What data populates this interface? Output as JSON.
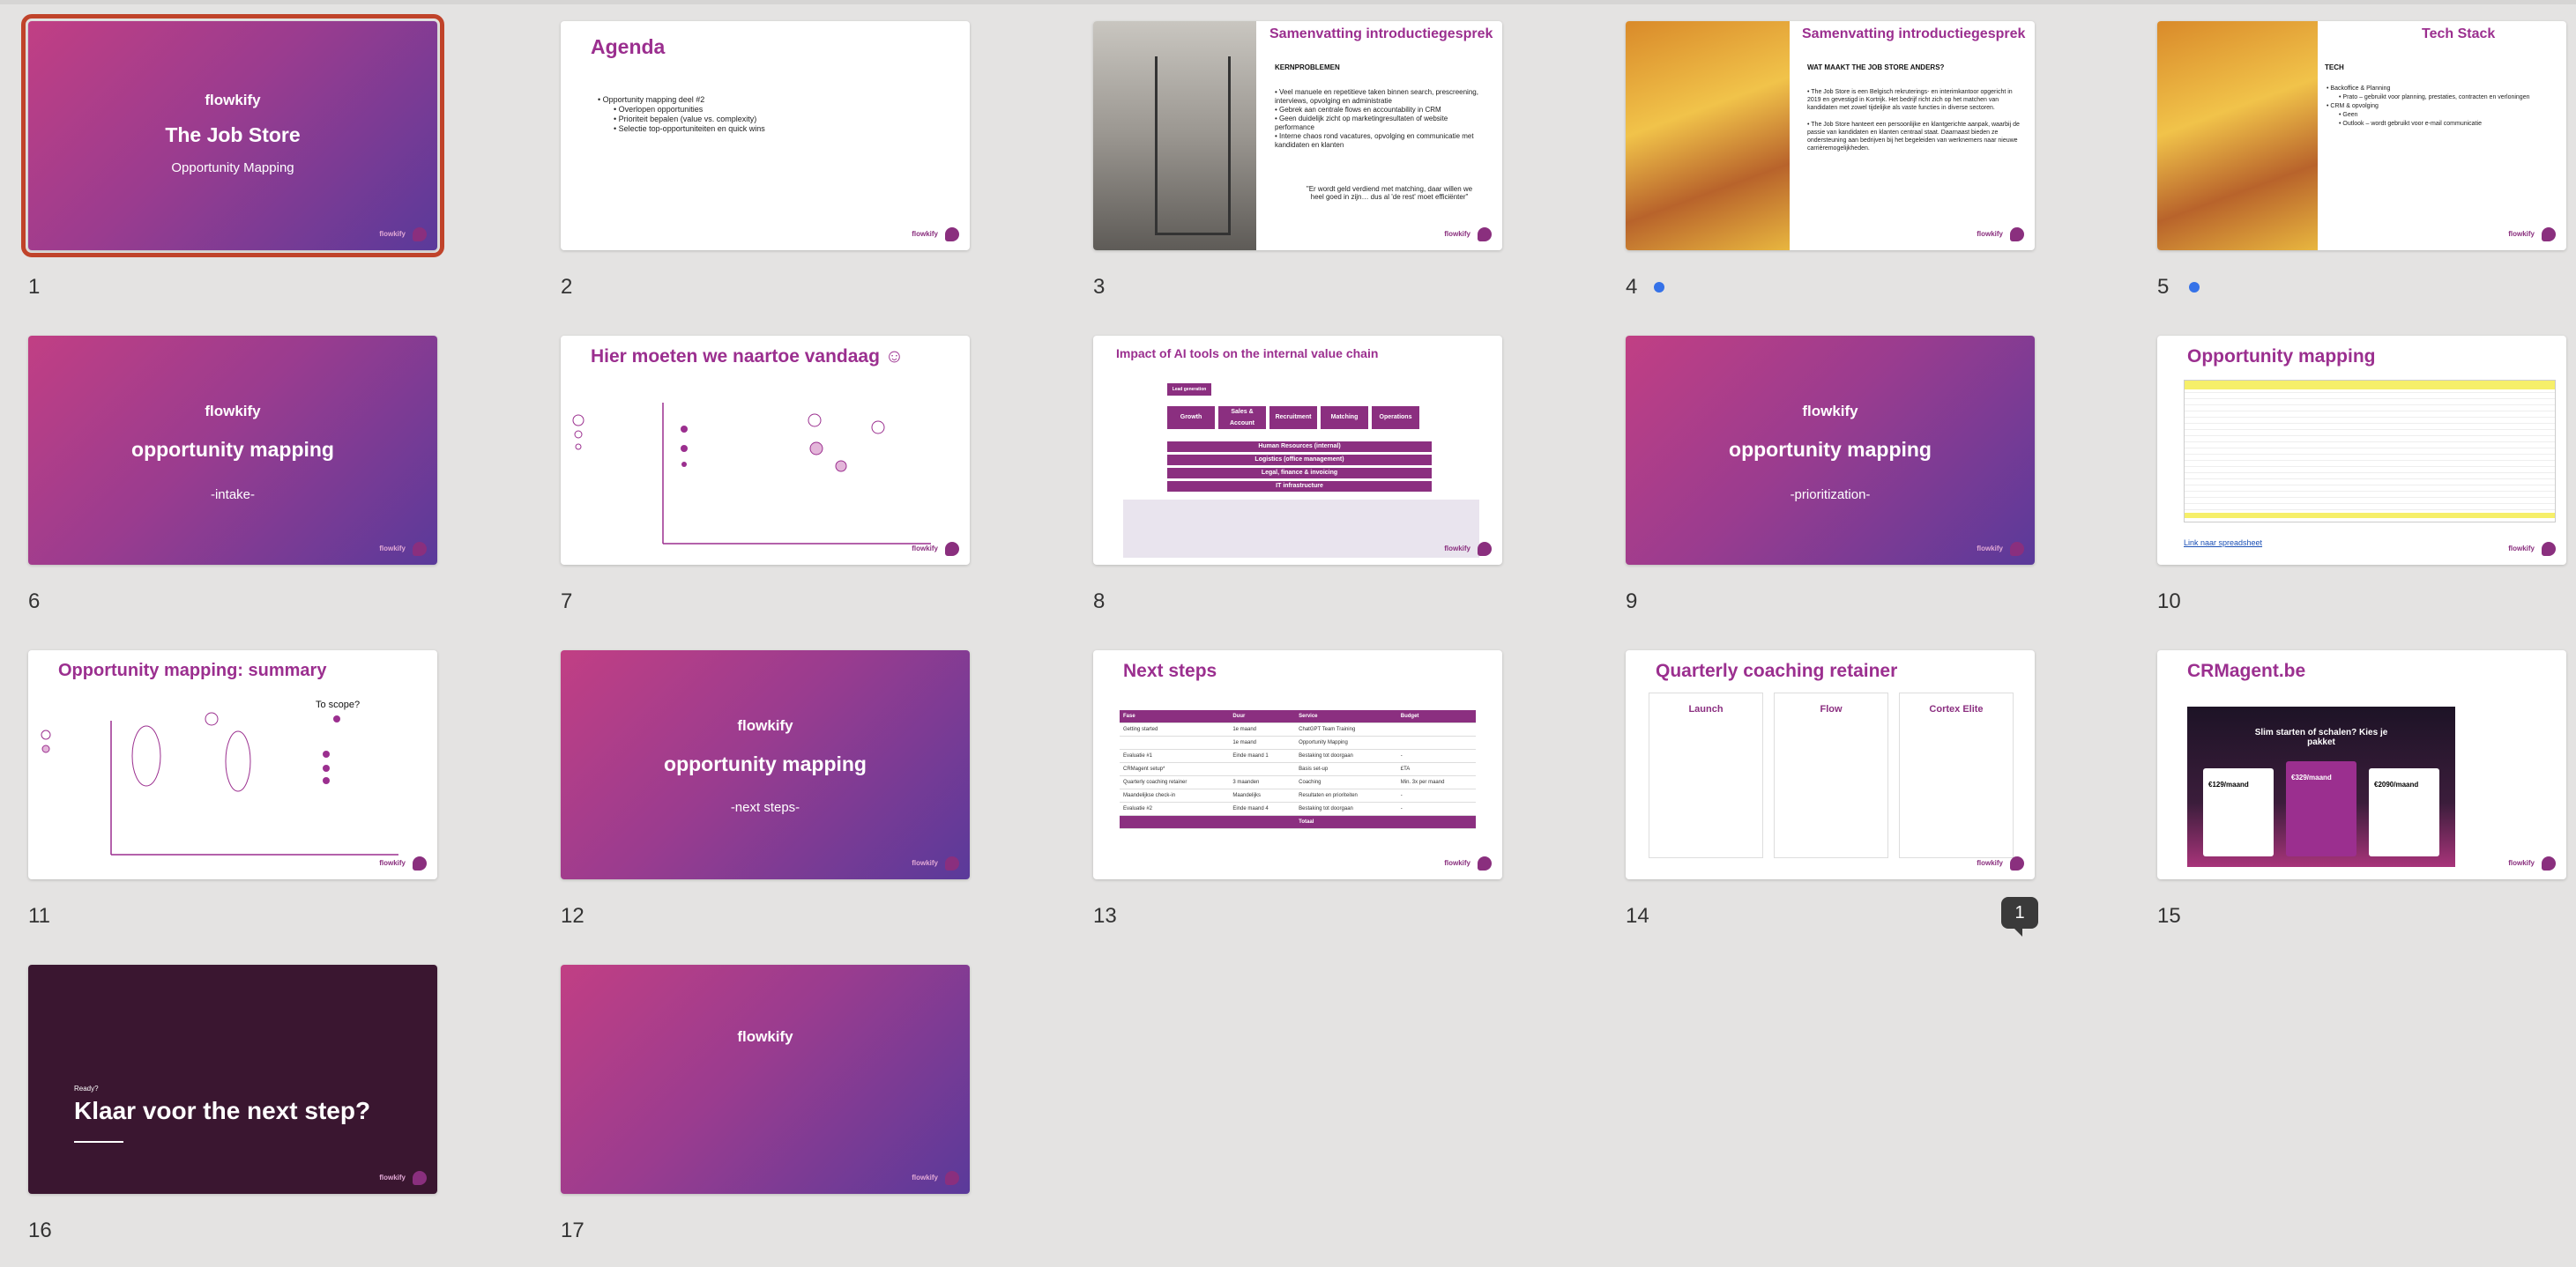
{
  "colors": {
    "accent": "#9b2f8f",
    "selection": "#c0432a",
    "dot": "#3572e8"
  },
  "slides": [
    {
      "num": "1",
      "brand": "flowkify",
      "title": "The Job Store",
      "subtitle": "Opportunity Mapping"
    },
    {
      "num": "2",
      "title": "Agenda",
      "bullets": [
        "Opportunity mapping deel #2",
        "Overlopen opportunities",
        "Prioriteit bepalen (value vs. complexity)",
        "Selectie top-opportuniteiten en quick wins"
      ]
    },
    {
      "num": "3",
      "title": "Samenvatting introductiegesprek",
      "section": "KERNPROBLEMEN",
      "bullets": [
        "Veel manuele en repetitieve taken binnen search, prescreening, interviews, opvolging en administratie",
        "Gebrek aan centrale flows en accountability in CRM",
        "Geen duidelijk zicht op marketingresultaten of website performance",
        "Interne chaos rond vacatures, opvolging en communicatie met kandidaten en klanten"
      ],
      "quote": "\"Er wordt geld verdiend met matching, daar willen we heel goed in zijn… dus al 'de rest' moet efficiënter\""
    },
    {
      "num": "4",
      "title": "Samenvatting introductiegesprek",
      "section": "WAT MAAKT THE JOB STORE ANDERS?",
      "bullets": [
        "The Job Store is een Belgisch rekruterings- en interimkantoor opgericht in 2019 en gevestigd in Kortrijk. Het bedrijf richt zich op het matchen van kandidaten met zowel tijdelijke als vaste functies in diverse sectoren.",
        "The Job Store hanteert een persoonlijke en klantgerichte aanpak, waarbij de passie van kandidaten en klanten centraal staat. Daarnaast bieden ze ondersteuning aan bedrijven bij het begeleiden van werknemers naar nieuwe carrièremogelijkheden."
      ]
    },
    {
      "num": "5",
      "title": "Tech Stack",
      "section": "TECH",
      "bullets": [
        "Backoffice & Planning",
        "Prato – gebruikt voor planning, prestaties, contracten en verloningen",
        "CRM & opvolging",
        "Geen",
        "Outlook – wordt gebruikt voor e-mail communicatie"
      ]
    },
    {
      "num": "6",
      "brand": "flowkify",
      "title": "opportunity mapping",
      "subtitle": "-intake-"
    },
    {
      "num": "7",
      "title": "Hier moeten we naartoe vandaag ☺"
    },
    {
      "num": "8",
      "title": "Impact of AI tools on the internal value chain",
      "chain": [
        "Lead generation",
        "Growth Marketing",
        "Sales & Account management",
        "Recruitment",
        "Matching",
        "Operations"
      ],
      "support": [
        "Human Resources (internal)",
        "Logistics (office management)",
        "Legal, finance & invoicing",
        "IT infrastructure"
      ]
    },
    {
      "num": "9",
      "brand": "flowkify",
      "title": "opportunity mapping",
      "subtitle": "-prioritization-"
    },
    {
      "num": "10",
      "title": "Opportunity mapping",
      "link": "Link naar spreadsheet"
    },
    {
      "num": "11",
      "title": "Opportunity mapping: summary",
      "scope": "To scope?"
    },
    {
      "num": "12",
      "brand": "flowkify",
      "title": "opportunity mapping",
      "subtitle": "-next steps-"
    },
    {
      "num": "13",
      "title": "Next steps",
      "headers": [
        "Fase",
        "Duur",
        "Service",
        "Budget"
      ],
      "rows": [
        [
          "Getting started",
          "1e maand",
          "ChatGPT Team Training",
          ""
        ],
        [
          "",
          "1e maand",
          "Opportunity Mapping",
          ""
        ],
        [
          "Evaluatie #1",
          "Einde maand 1",
          "Bestaking tot doorgaan",
          "-"
        ],
        [
          "CRMagent setup*",
          "",
          "Basis set-up",
          "£TA"
        ],
        [
          "Quarterly coaching retainer",
          "3 maanden",
          "Coaching",
          "Min. 3x per maand"
        ],
        [
          "Maandelijkse check-in",
          "Maandelijks",
          "Resultaten en prioriteiten",
          "-"
        ],
        [
          "Evaluatie #2",
          "Einde maand 4",
          "Bestaking tot doorgaan",
          "-"
        ]
      ],
      "total": "Totaal"
    },
    {
      "num": "14",
      "title": "Quarterly coaching retainer",
      "tiers": [
        "Launch",
        "Flow",
        "Cortex Elite"
      ]
    },
    {
      "num": "15",
      "title": "CRMagent.be",
      "hero": "Slim starten of schalen? Kies je pakket",
      "prices": [
        "€129/maand",
        "€329/maand",
        "€2090/maand"
      ]
    },
    {
      "num": "16",
      "kicker": "Ready?",
      "title": "Klaar voor the next step?"
    },
    {
      "num": "17",
      "brand": "flowkify"
    }
  ],
  "comment_count": "1",
  "footer_brand": "flowkify"
}
